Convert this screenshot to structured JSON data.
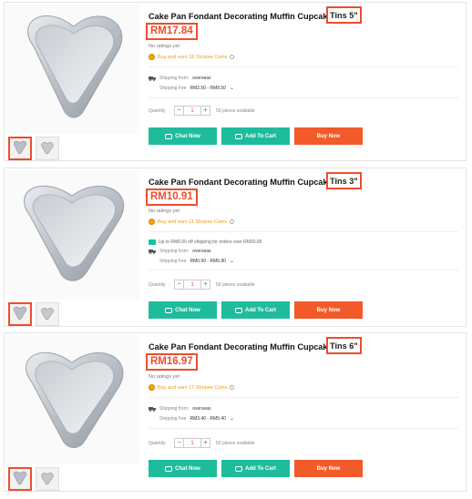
{
  "products": [
    {
      "title_main": "Cake Pan Fondant Decorating Muffin Cupcake Mold",
      "title_variant": "Tins 5\"",
      "price": "RM17.84",
      "ratings": "No ratings yet",
      "coins": "Buy and earn 18 Shopee Coins",
      "promo": "",
      "shipping_label": "Shipping from:",
      "shipping_from": "overseas",
      "fee_label": "Shipping Fee",
      "fee_value": "RM2.50 - RM8.50",
      "qty_label": "Quantity",
      "qty_value": "1",
      "qty_available": "50 pieces available",
      "chat_label": "Chat Now",
      "cart_label": "Add To Cart",
      "buy_label": "Buy Now"
    },
    {
      "title_main": "Cake Pan Fondant Decorating Muffin Cupcake Mold",
      "title_variant": "Tins 3\"",
      "price": "RM10.91",
      "ratings": "No ratings yet",
      "coins": "Buy and earn 11 Shopee Coins",
      "promo": "Up to RM6.00 off shipping for orders over RM30.00",
      "shipping_label": "Shipping from:",
      "shipping_from": "overseas",
      "fee_label": "Shipping Fee",
      "fee_value": "RM0.90 - RM6.90",
      "qty_label": "Quantity",
      "qty_value": "1",
      "qty_available": "50 pieces available",
      "chat_label": "Chat Now",
      "cart_label": "Add To Cart",
      "buy_label": "Buy Now"
    },
    {
      "title_main": "Cake Pan Fondant Decorating Muffin Cupcake Mold",
      "title_variant": "Tins 6\"",
      "price": "RM16.97",
      "ratings": "No ratings yet",
      "coins": "Buy and earn 17 Shopee Coins",
      "promo": "",
      "shipping_label": "Shipping from:",
      "shipping_from": "overseas",
      "fee_label": "Shipping Fee",
      "fee_value": "RM3.40 - RM5.40",
      "qty_label": "Quantity",
      "qty_value": "1",
      "qty_available": "50 pieces available",
      "chat_label": "Chat Now",
      "cart_label": "Add To Cart",
      "buy_label": "Buy Now"
    }
  ],
  "icons": {
    "coin": "shopee-coin-icon",
    "truck": "truck-icon",
    "chat": "chat-icon",
    "cart": "cart-icon"
  },
  "colors": {
    "brand": "#ee4d2d",
    "teal": "#1fbc9c",
    "buy": "#f25a29",
    "coin": "#f6a700"
  }
}
